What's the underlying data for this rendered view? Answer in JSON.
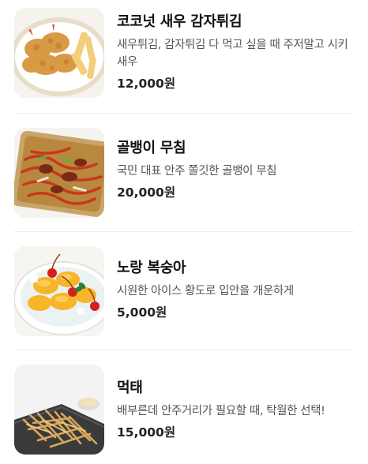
{
  "menu": {
    "items": [
      {
        "name": "코코넛 새우 감자튀김",
        "description": "새우튀김, 감자튀김 다 먹고 싶을 때 주저말고 시키새우",
        "price": "12,000원",
        "image": "fried-shrimp-fries-photo"
      },
      {
        "name": "골뱅이 무침",
        "description": "국민 대표 안주 쫄깃한 골뱅이 무침",
        "price": "20,000원",
        "image": "whelk-salad-photo"
      },
      {
        "name": "노랑 복숭아",
        "description": "시원한 아이스 황도로 입안을 개운하게",
        "price": "5,000원",
        "image": "yellow-peach-photo"
      },
      {
        "name": "먹태",
        "description": "배부른데 안주거리가 필요할 때, 탁월한 선택!",
        "price": "15,000원",
        "image": "dried-pollack-photo"
      }
    ]
  }
}
